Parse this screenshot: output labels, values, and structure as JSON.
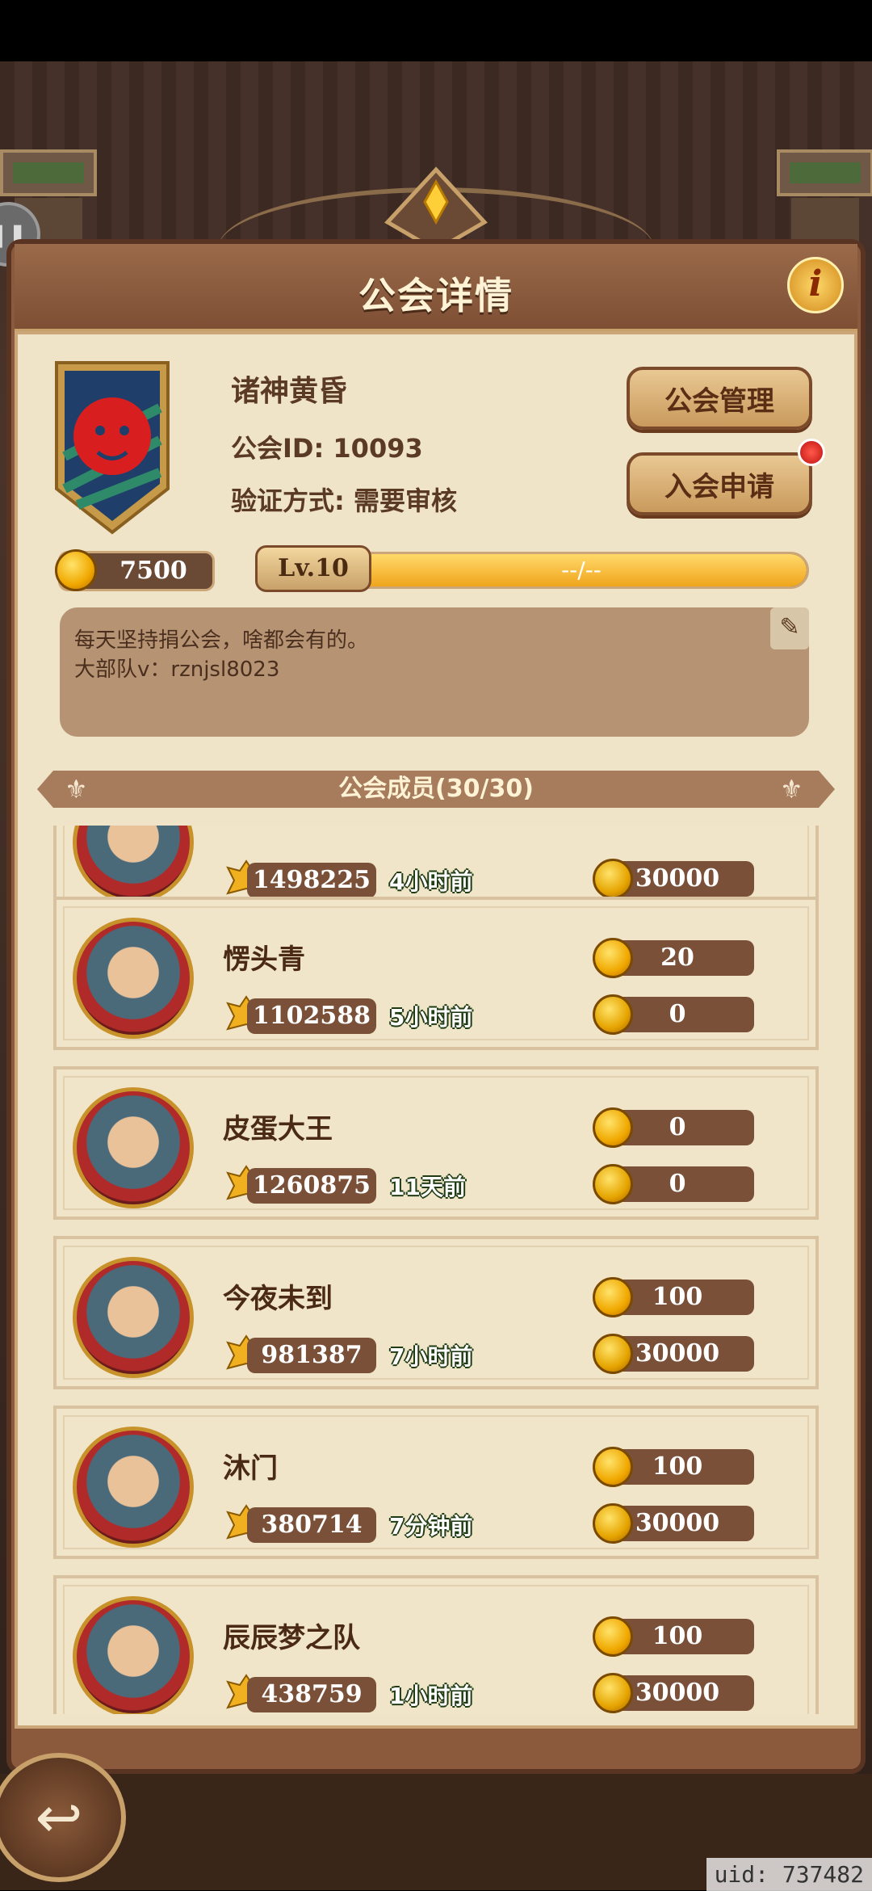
{
  "header": {
    "title": "公会详情"
  },
  "guild": {
    "name": "诸神黄昏",
    "id_text": "公会ID: 10093",
    "verify_text": "验证方式: 需要审核",
    "funds": "7500",
    "level_label": "Lv.10",
    "exp_text": "--/--",
    "exp_fraction": 1.0,
    "notice_line1": "每天坚持捐公会，啥都会有的。",
    "notice_line2": "大部队v：rznjsl8023"
  },
  "buttons": {
    "manage": "公会管理",
    "apply": "入会申请"
  },
  "members_title": "公会成员(30/30)",
  "members": [
    {
      "name": "",
      "power": "1498225",
      "last_online": "4小时前",
      "donate": "",
      "contrib": "30000"
    },
    {
      "name": "愣头青",
      "power": "1102588",
      "last_online": "5小时前",
      "donate": "20",
      "contrib": "0"
    },
    {
      "name": "皮蛋大王",
      "power": "1260875",
      "last_online": "11天前",
      "donate": "0",
      "contrib": "0"
    },
    {
      "name": "今夜未到",
      "power": "981387",
      "last_online": "7小时前",
      "donate": "100",
      "contrib": "30000"
    },
    {
      "name": "沐门",
      "power": "380714",
      "last_online": "7分钟前",
      "donate": "100",
      "contrib": "30000"
    },
    {
      "name": "辰辰梦之队",
      "power": "438759",
      "last_online": "1小时前",
      "donate": "100",
      "contrib": "30000"
    }
  ],
  "footer": {
    "uid": "uid: 737482"
  },
  "colors": {
    "panel": "#8b5a3c",
    "parchment": "#efe3c8",
    "pill": "#7a5038",
    "gold": "#f0a800",
    "badge_red": "#c01010"
  },
  "icons": {
    "info": "info-icon",
    "coin": "coin-icon",
    "edit": "quill-edit-icon",
    "power": "power-crest-icon",
    "back": "back-arrow-icon",
    "pause": "pause-icon"
  }
}
